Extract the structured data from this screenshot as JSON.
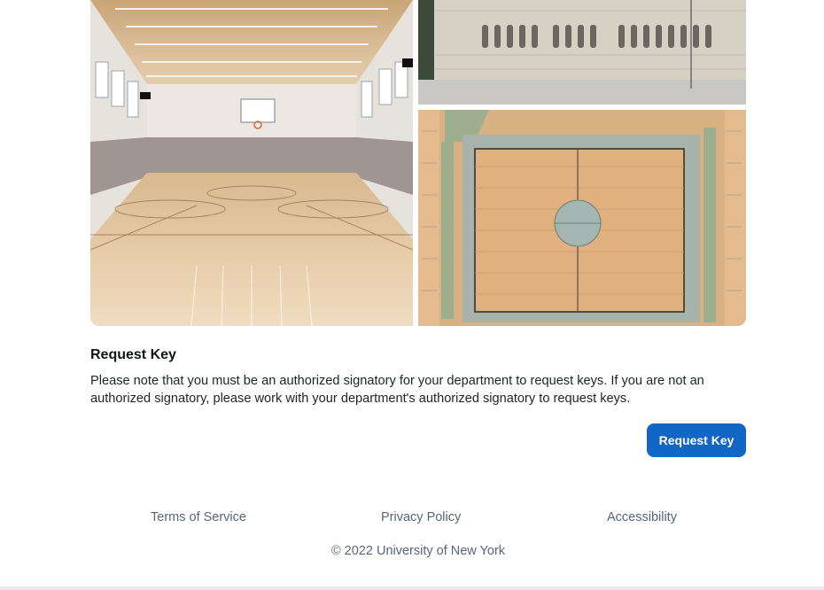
{
  "images": [
    {
      "name": "indoor-gymnasium-photo"
    },
    {
      "name": "building-facade-photo"
    },
    {
      "name": "court-floor-plan-photo"
    }
  ],
  "request": {
    "title": "Request Key",
    "notice": "Please note that you must be an authorized signatory for your department to request keys. If you are not an authorized signatory, please work with your department's authorized signatory to request keys.",
    "button_label": "Request Key"
  },
  "footer": {
    "links": [
      "Terms of Service",
      "Privacy Policy",
      "Accessibility"
    ],
    "copyright": "© 2022 University of New York"
  },
  "colors": {
    "primary_button": "#1166c6",
    "footer_text": "#5a6577"
  }
}
